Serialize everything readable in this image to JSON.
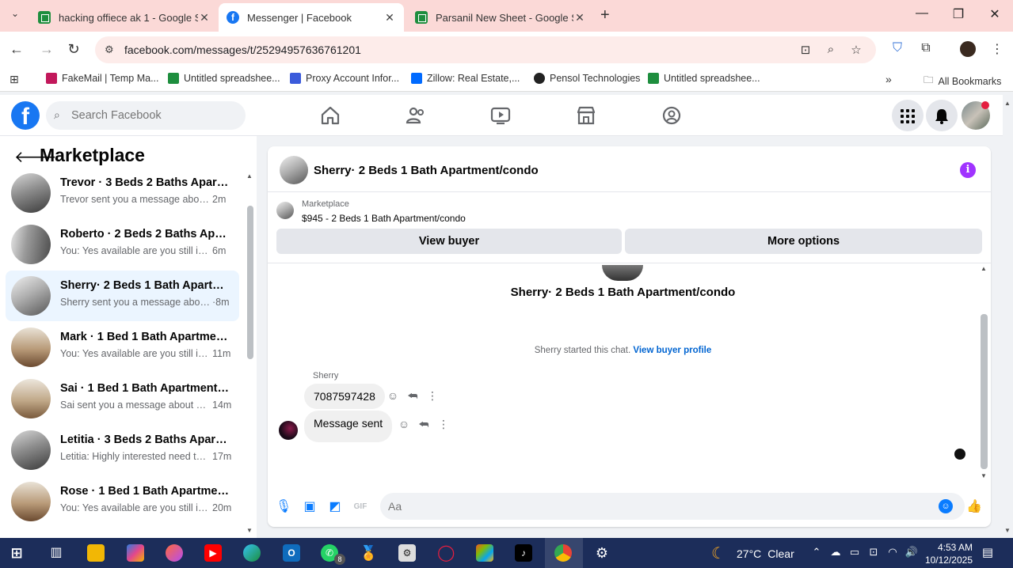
{
  "browser": {
    "tabs": [
      {
        "title": "hacking offiece ak 1 - Google Sh",
        "icon": "sheets-icon"
      },
      {
        "title": "Messenger | Facebook",
        "icon": "facebook-icon"
      },
      {
        "title": "Parsanil New Sheet - Google She",
        "icon": "sheets-icon"
      }
    ],
    "url": "facebook.com/messages/t/25294957636761201",
    "bookmarks": [
      {
        "label": "FakeMail | Temp Ma...",
        "color": "#c2185b"
      },
      {
        "label": "Untitled spreadshee...",
        "color": "#1e8e3e"
      },
      {
        "label": "Proxy Account Infor...",
        "color": "#3b5bdb"
      },
      {
        "label": "Zillow: Real Estate,...",
        "color": "#006aff"
      },
      {
        "label": "Pensol Technologies",
        "color": "#222222"
      },
      {
        "label": "Untitled spreadshee...",
        "color": "#1e8e3e"
      }
    ],
    "all_bookmarks": "All Bookmarks"
  },
  "facebook": {
    "logo_letter": "f",
    "search_placeholder": "Search Facebook",
    "accent": "#1877f2"
  },
  "sidebar": {
    "title": "Marketplace",
    "conversations": [
      {
        "name": "Trevor · 3 Beds 2 Baths Apartme...",
        "preview": "Trevor sent you a message about y...",
        "time": "2m"
      },
      {
        "name": "Roberto · 2 Beds 2 Baths Apart...",
        "preview": "You: Yes available are you still inter...",
        "time": "6m"
      },
      {
        "name": "Sherry· 2 Beds 1 Bath Apartmen...",
        "preview": "Sherry sent you a message about ...",
        "time": "·8m"
      },
      {
        "name": "Mark · 1 Bed 1 Bath Apartment/...",
        "preview": "You: Yes available are you still int...",
        "time": "11m"
      },
      {
        "name": "Sai · 1 Bed 1 Bath Apartment/co...",
        "preview": "Sai sent you a message about yo...",
        "time": "14m"
      },
      {
        "name": "Letitia · 3 Beds 2 Baths Apartme...",
        "preview": "Letitia: Highly interested need to ...",
        "time": "17m"
      },
      {
        "name": "Rose · 1 Bed 1 Bath Apartment/c...",
        "preview": "You: Yes available are you still int...",
        "time": "20m"
      }
    ]
  },
  "chat": {
    "header_title": "Sherry· 2 Beds 1 Bath Apartment/condo",
    "listing_label": "Marketplace",
    "listing_price": "$945 - 2 Beds 1 Bath Apartment/condo",
    "view_buyer": "View buyer",
    "more_options": "More options",
    "conversation_title": "Sherry· 2 Beds 1 Bath Apartment/condo",
    "started_text": "Sherry started this chat.",
    "view_buyer_profile": "View buyer profile",
    "sender_name": "Sherry",
    "messages": [
      {
        "text": "7087597428"
      },
      {
        "text": "Message sent"
      }
    ],
    "composer_placeholder": "Aa"
  },
  "taskbar": {
    "whatsapp_badge": "8",
    "weather_temp": "27°C",
    "weather_desc": "Clear",
    "time": "4:53 AM",
    "date": "10/12/2025"
  }
}
